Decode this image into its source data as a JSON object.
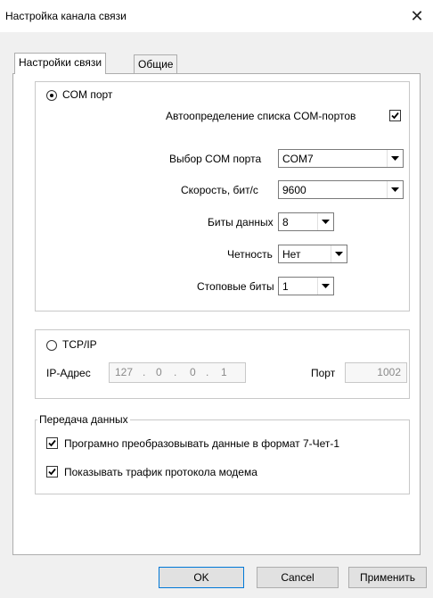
{
  "window": {
    "title": "Настройка канала связи",
    "close_glyph": "✕"
  },
  "tabs": [
    {
      "label": "Настройки связи",
      "active": true
    },
    {
      "label": "Общие",
      "active": false
    }
  ],
  "com": {
    "radio_label": "COM порт",
    "selected": true,
    "autodetect_label": "Автоопределение списка COM-портов",
    "autodetect_checked": true,
    "port_label": "Выбор COM порта",
    "port_value": "COM7",
    "speed_label": "Скорость, бит/с",
    "speed_value": "9600",
    "databits_label": "Биты данных",
    "databits_value": "8",
    "parity_label": "Четность",
    "parity_value": "Нет",
    "stopbits_label": "Стоповые биты",
    "stopbits_value": "1"
  },
  "tcp": {
    "radio_label": "TCP/IP",
    "selected": false,
    "ip_label": "IP-Адрес",
    "ip_octets": [
      "127",
      "0",
      "0",
      "1"
    ],
    "port_label": "Порт",
    "port_value": "1002"
  },
  "transfer": {
    "legend": "Передача данных",
    "convert_label": "Програмно преобразовывать данные в формат 7-Чет-1",
    "convert_checked": true,
    "traffic_label": "Показывать трафик протокола модема",
    "traffic_checked": true
  },
  "buttons": {
    "ok": "OK",
    "cancel": "Cancel",
    "apply": "Применить"
  },
  "colors": {
    "focus_border": "#0078d7",
    "window_bg": "#f0f0f0"
  }
}
